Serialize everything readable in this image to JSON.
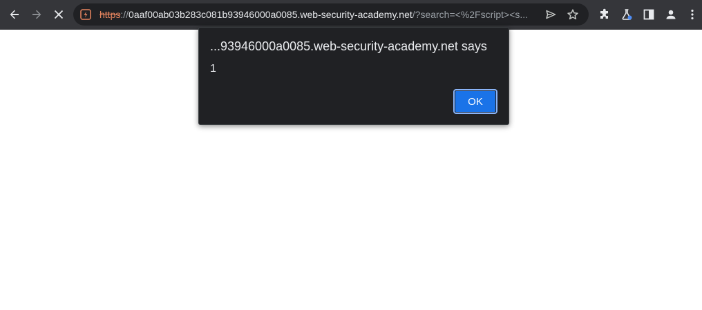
{
  "browser": {
    "toolbar_icons": {
      "back": "arrow-left-icon",
      "forward": "arrow-right-icon",
      "stop": "close-icon",
      "site_info": "not-secure-icon",
      "send": "send-icon",
      "bookmark": "star-icon",
      "extensions": "puzzle-icon",
      "labs": "flask-icon",
      "side_panel": "side-panel-icon",
      "profile": "person-icon",
      "menu": "kebab-menu-icon"
    },
    "url": {
      "scheme": "https",
      "separator": "://",
      "host": "0aaf00ab03b283c081b93946000a0085.web-security-academy.net",
      "rest": "/?search=<%2Fscript><s..."
    },
    "colors": {
      "toolbar": "#35363a",
      "omnibox": "#202124",
      "not_secure": "#e8865f"
    }
  },
  "alert_dialog": {
    "title": "...93946000a0085.web-security-academy.net says",
    "message": "1",
    "ok_label": "OK",
    "colors": {
      "background": "#202124",
      "button": "#1a73e8"
    }
  }
}
